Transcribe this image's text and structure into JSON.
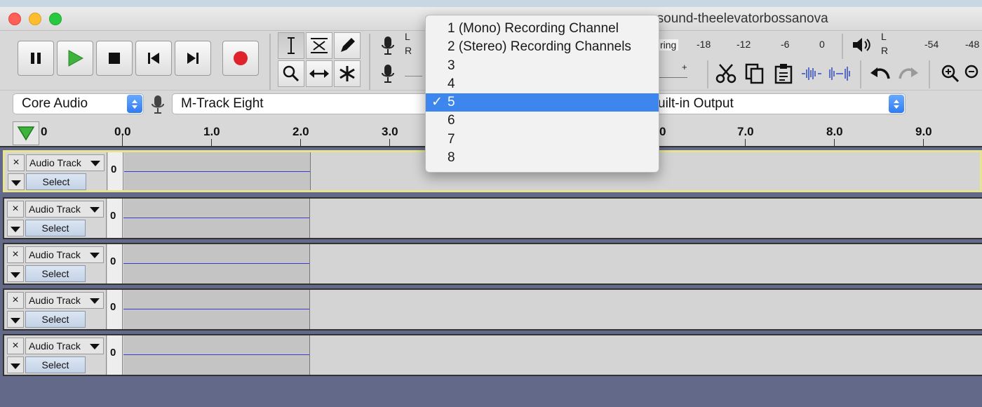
{
  "window": {
    "title_fragment": "~nsound-theelevatorbossanova"
  },
  "meters": {
    "record_lr": [
      "L",
      "R"
    ],
    "record_scale_visible": [
      "ring",
      "-18",
      "-12",
      "-6",
      "0"
    ],
    "record_slider_end": "+",
    "playback_lr": [
      "L",
      "R"
    ],
    "playback_scale_visible": [
      "-54",
      "-48"
    ]
  },
  "device_toolbar": {
    "host": "Core Audio",
    "recording_device": "M-Track Eight",
    "playback_device": "uilt-in Output"
  },
  "channels_menu": {
    "items": [
      {
        "label": "1 (Mono) Recording Channel",
        "selected": false
      },
      {
        "label": "2 (Stereo) Recording Channels",
        "selected": false
      },
      {
        "label": "3",
        "selected": false
      },
      {
        "label": "4",
        "selected": false
      },
      {
        "label": "5",
        "selected": true
      },
      {
        "label": "6",
        "selected": false
      },
      {
        "label": "7",
        "selected": false
      },
      {
        "label": "8",
        "selected": false
      }
    ],
    "check_mark": "✓"
  },
  "ruler": {
    "labels": [
      "0",
      "0.0",
      "1.0",
      "2.0",
      "3.0",
      "0",
      "7.0",
      "8.0",
      "9.0"
    ]
  },
  "tracks": [
    {
      "name": "Audio Track",
      "select_label": "Select",
      "close_label": "×",
      "scale_label": "0",
      "selected": true
    },
    {
      "name": "Audio Track",
      "select_label": "Select",
      "close_label": "×",
      "scale_label": "0",
      "selected": false
    },
    {
      "name": "Audio Track",
      "select_label": "Select",
      "close_label": "×",
      "scale_label": "0",
      "selected": false
    },
    {
      "name": "Audio Track",
      "select_label": "Select",
      "close_label": "×",
      "scale_label": "0",
      "selected": false
    },
    {
      "name": "Audio Track",
      "select_label": "Select",
      "close_label": "×",
      "scale_label": "0",
      "selected": false
    }
  ],
  "colors": {
    "background": "#636a89",
    "selected_menu_item": "#3c86ee",
    "waveform": "#3a3ad0",
    "play_green": "#3db33d",
    "record_red": "#e0232a",
    "selected_track_border": "#e7e38f"
  }
}
